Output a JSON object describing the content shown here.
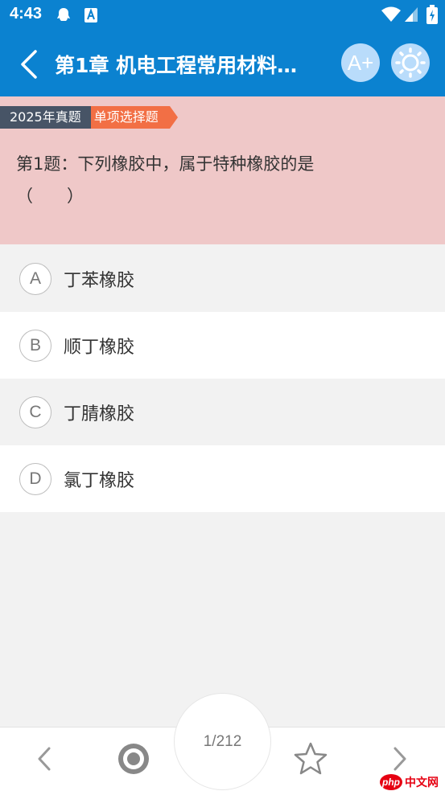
{
  "status_bar": {
    "time": "4:43"
  },
  "app_bar": {
    "title": "第1章 机电工程常用材料…",
    "font_button_label": "A+"
  },
  "question": {
    "tag_year": "2025年真题",
    "tag_type": "单项选择题",
    "text_line1": "第1题：下列橡胶中，属于特种橡胶的是",
    "text_line2": "（　　）"
  },
  "options": [
    {
      "letter": "A",
      "text": "丁苯橡胶"
    },
    {
      "letter": "B",
      "text": "顺丁橡胶"
    },
    {
      "letter": "C",
      "text": "丁腈橡胶"
    },
    {
      "letter": "D",
      "text": "氯丁橡胶"
    }
  ],
  "bottom_bar": {
    "page_indicator": "1/212"
  },
  "watermark": {
    "logo": "php",
    "text": "中文网"
  },
  "colors": {
    "primary": "#0b82d0",
    "question_bg": "#efc8c8",
    "tag_year_bg": "#475466",
    "tag_type_bg": "#f26f45"
  }
}
